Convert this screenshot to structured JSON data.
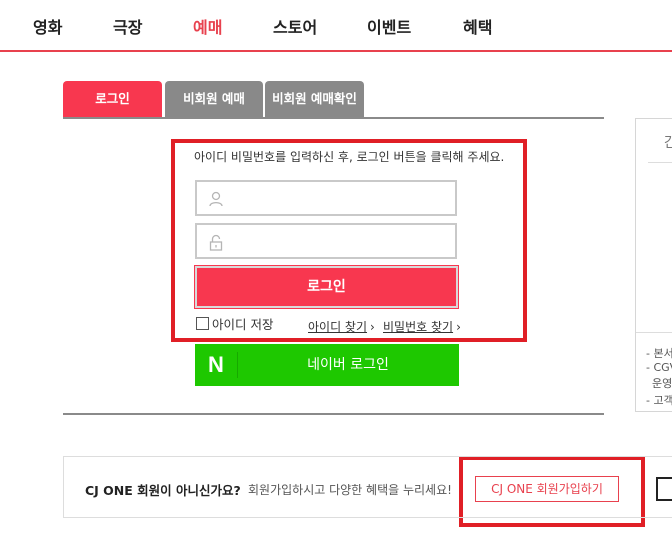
{
  "nav": [
    "영화",
    "극장",
    "예매",
    "스토어",
    "이벤트",
    "혜택"
  ],
  "tabs": {
    "login": "로그인",
    "nonmember_booking": "비회원 예매",
    "nonmember_check": "비회원 예매확인"
  },
  "login": {
    "instruction": "아이디 비밀번호를 입력하신 후, 로그인 버튼을 클릭해 주세요.",
    "button": "로그인",
    "remember_id": "아이디 저장",
    "find_id": "아이디 찾기",
    "find_password": "비밀번호 찾기",
    "chevron": "›"
  },
  "naver": {
    "logo": "N",
    "label": "네이버 로그인"
  },
  "side": {
    "top": "간",
    "items": [
      "- 본서",
      "- CGV",
      "운영",
      "- 고객"
    ]
  },
  "cjone": {
    "question": "CJ ONE 회원이 아니신가요?",
    "description": "회원가입하시고 다양한 혜택을 누리세요!",
    "button": "CJ ONE 회원가입하기"
  },
  "colors": {
    "accent": "#f8374f",
    "nav_active": "#e8414e",
    "naver": "#1ec800",
    "highlight_box": "#e01f26"
  }
}
